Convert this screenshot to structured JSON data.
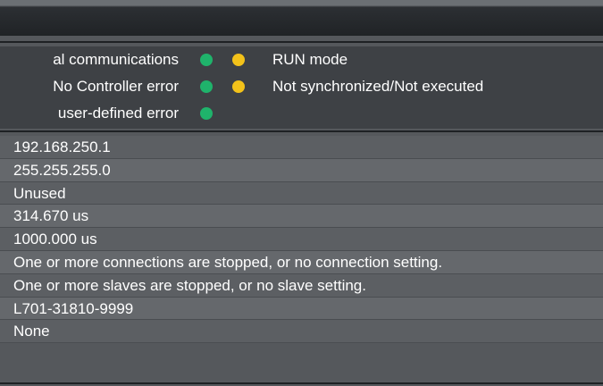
{
  "status": {
    "labels": [
      "al communications",
      "No Controller error",
      "user-defined error"
    ],
    "indicators": [
      {
        "text": "RUN mode",
        "color": "#f3c21a"
      },
      {
        "text": "Not synchronized/Not executed",
        "color": "#f3c21a"
      }
    ],
    "led_green_color": "#1fb36b"
  },
  "values": [
    "192.168.250.1",
    "255.255.255.0",
    "Unused",
    "314.670 us",
    "1000.000 us",
    "One or more connections are stopped, or no connection setting.",
    "One or more slaves are stopped, or no slave setting.",
    "L701-31810-9999",
    "None"
  ]
}
